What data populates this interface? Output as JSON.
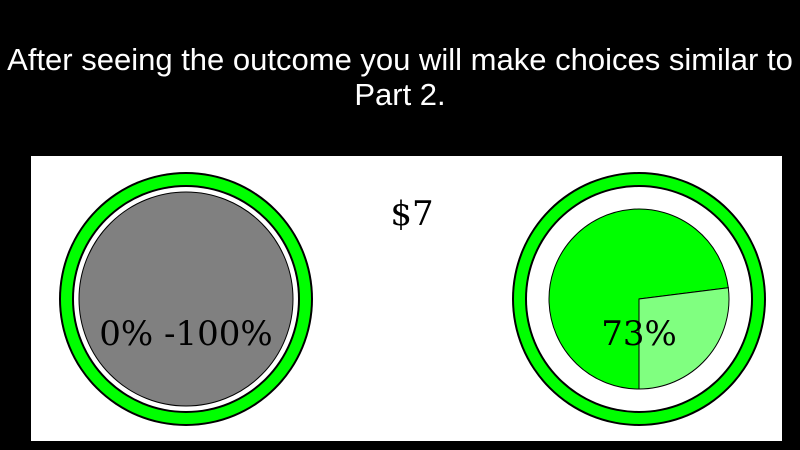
{
  "instruction": "After seeing the outcome you will make choices similar to Part 2.",
  "amount": "$7",
  "left_option": {
    "label": "0% -100%",
    "ring_color": "#00ff00",
    "fill_color": "#808080"
  },
  "right_option": {
    "label": "73%",
    "probability": 0.73,
    "ring_color": "#00ff00",
    "fill_color": "#00ff00",
    "remainder_color": "#80ff80"
  },
  "colors": {
    "background": "#000000",
    "panel": "#ffffff",
    "text": "#000000"
  }
}
